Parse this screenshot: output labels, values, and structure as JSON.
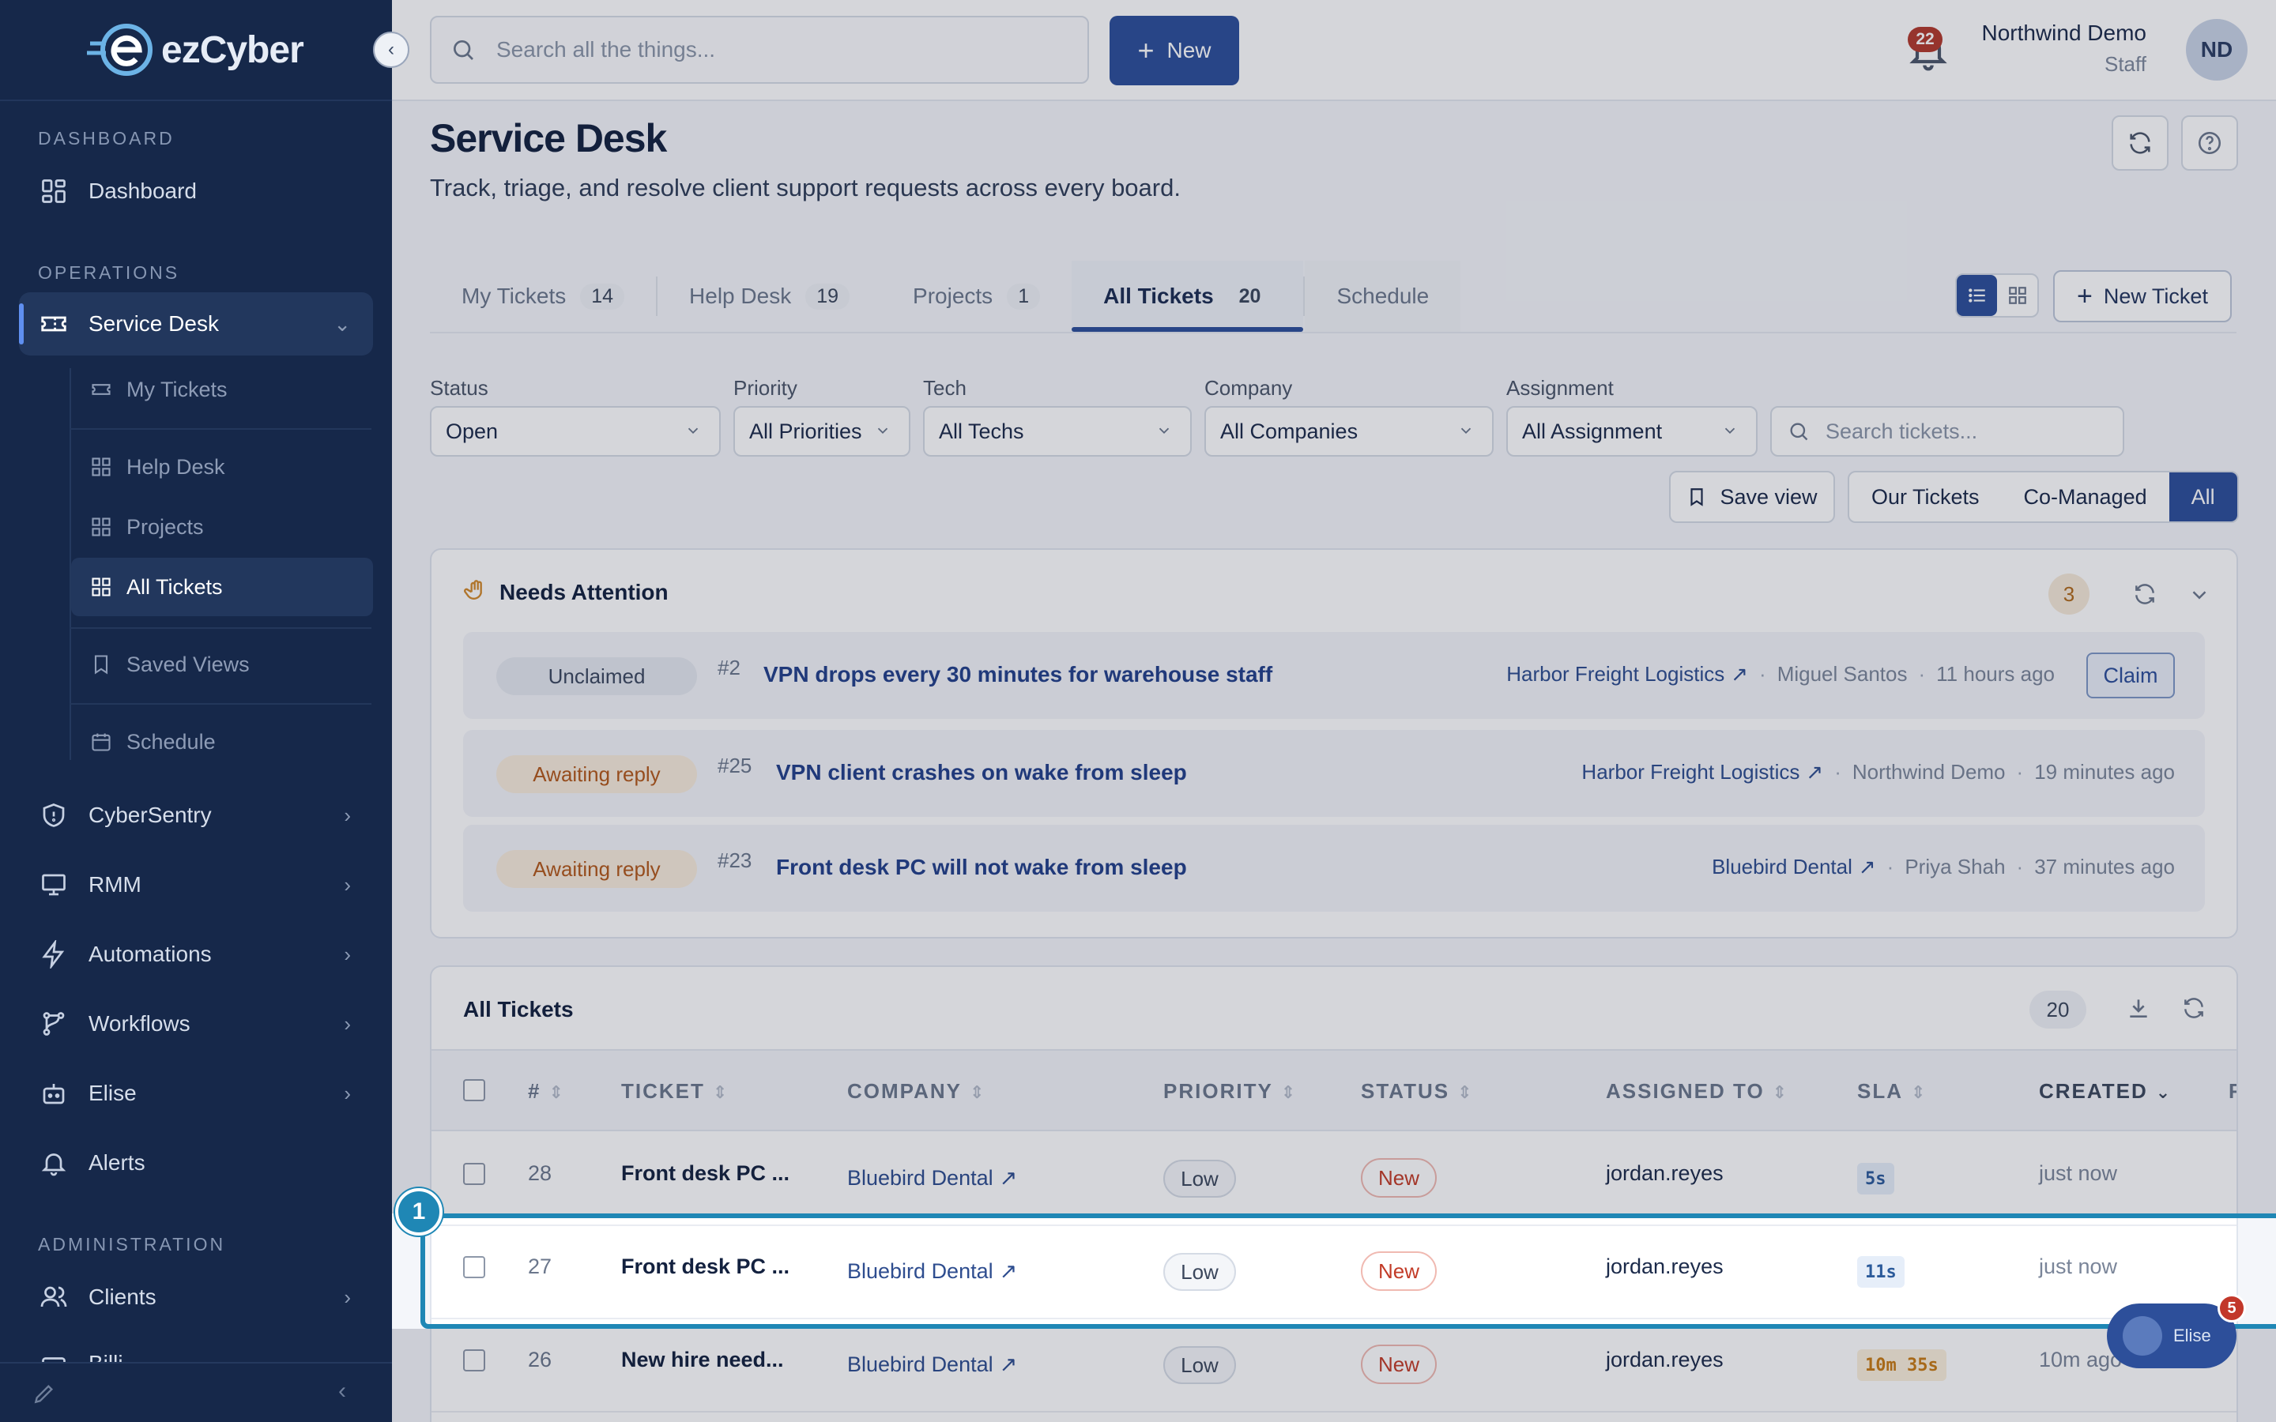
{
  "app": {
    "logo_text": "ezCyber"
  },
  "sidebar": {
    "sections": {
      "dashboard": "DASHBOARD",
      "operations": "OPERATIONS",
      "administration": "ADMINISTRATION"
    },
    "items": {
      "dashboard": "Dashboard",
      "service_desk": "Service Desk",
      "cybersentry": "CyberSentry",
      "rmm": "RMM",
      "automations": "Automations",
      "workflows": "Workflows",
      "elise": "Elise",
      "alerts": "Alerts",
      "clients": "Clients",
      "billing": "Billi"
    },
    "sub_items": {
      "my_tickets": "My Tickets",
      "help_desk": "Help Desk",
      "projects": "Projects",
      "all_tickets": "All Tickets",
      "saved_views": "Saved Views",
      "schedule": "Schedule"
    }
  },
  "topbar": {
    "search_placeholder": "Search all the things...",
    "new_label": "New",
    "notifications_count": "22",
    "user_name": "Northwind Demo",
    "user_role": "Staff",
    "user_initials": "ND"
  },
  "page": {
    "title": "Service Desk",
    "subtitle": "Track, triage, and resolve client support requests across every board."
  },
  "tabs": [
    {
      "label": "My Tickets",
      "count": "14"
    },
    {
      "label": "Help Desk",
      "count": "19"
    },
    {
      "label": "Projects",
      "count": "1"
    },
    {
      "label": "All Tickets",
      "count": "20"
    },
    {
      "label": "Schedule",
      "count": ""
    }
  ],
  "new_ticket_label": "New Ticket",
  "filters": {
    "status": {
      "label": "Status",
      "value": "Open"
    },
    "priority": {
      "label": "Priority",
      "value": "All Priorities"
    },
    "tech": {
      "label": "Tech",
      "value": "All Techs"
    },
    "company": {
      "label": "Company",
      "value": "All Companies"
    },
    "assignment": {
      "label": "Assignment",
      "value": "All Assignment"
    },
    "search_placeholder": "Search tickets...",
    "save_view": "Save view",
    "scope": [
      "Our Tickets",
      "Co-Managed",
      "All"
    ]
  },
  "needs_attention": {
    "title": "Needs Attention",
    "count": "3",
    "rows": [
      {
        "status": "Unclaimed",
        "num": "#2",
        "title": "VPN drops every 30 minutes for warehouse staff",
        "company": "Harbor Freight Logistics",
        "person": "Miguel Santos",
        "time": "11 hours ago",
        "action": "Claim"
      },
      {
        "status": "Awaiting reply",
        "num": "#25",
        "title": "VPN client crashes on wake from sleep",
        "company": "Harbor Freight Logistics",
        "person": "Northwind Demo",
        "time": "19 minutes ago"
      },
      {
        "status": "Awaiting reply",
        "num": "#23",
        "title": "Front desk PC will not wake from sleep",
        "company": "Bluebird Dental",
        "person": "Priya Shah",
        "time": "37 minutes ago"
      }
    ]
  },
  "tickets": {
    "title": "All Tickets",
    "count": "20",
    "columns": [
      "#",
      "TICKET",
      "COMPANY",
      "PRIORITY",
      "STATUS",
      "ASSIGNED TO",
      "SLA",
      "CREATED",
      "R"
    ],
    "rows": [
      {
        "num": "28",
        "title": "Front desk PC ...",
        "company": "Bluebird Dental",
        "priority": "Low",
        "status": "New",
        "assigned": "jordan.reyes",
        "sla": "5s",
        "created": "just now"
      },
      {
        "num": "27",
        "title": "Front desk PC ...",
        "company": "Bluebird Dental",
        "priority": "Low",
        "status": "New",
        "assigned": "jordan.reyes",
        "sla": "11s",
        "created": "just now"
      },
      {
        "num": "26",
        "title": "New hire need...",
        "company": "Bluebird Dental",
        "priority": "Low",
        "status": "New",
        "assigned": "jordan.reyes",
        "sla": "10m 35s",
        "created": "10m ago"
      }
    ]
  },
  "tour": {
    "step": "1"
  },
  "elise_widget": {
    "label": "Elise",
    "badge": "5"
  }
}
